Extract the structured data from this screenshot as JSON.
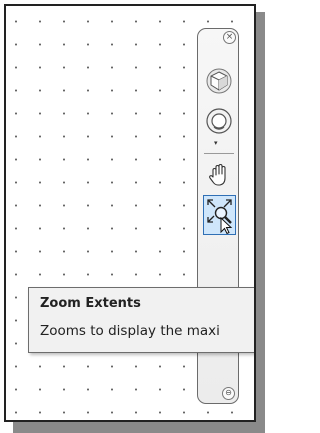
{
  "navigation_bar": {
    "close_glyph": "×",
    "bottom_glyph": "⊖",
    "drop_glyph": "▾",
    "buttons": [
      {
        "name": "viewcube-icon",
        "state": "normal"
      },
      {
        "name": "steering-wheel-icon",
        "state": "normal"
      },
      {
        "name": "pan-hand-icon",
        "state": "normal"
      },
      {
        "name": "zoom-extents-icon",
        "state": "active"
      },
      {
        "name": "showmotion-icon",
        "state": "normal"
      }
    ]
  },
  "tooltip": {
    "title": "Zoom Extents",
    "description": "Zooms to display the maxi"
  },
  "colors": {
    "active_bg": "#cfe6fb",
    "active_border": "#2f6fb5",
    "tooltip_bg": "#f1f1f1"
  }
}
